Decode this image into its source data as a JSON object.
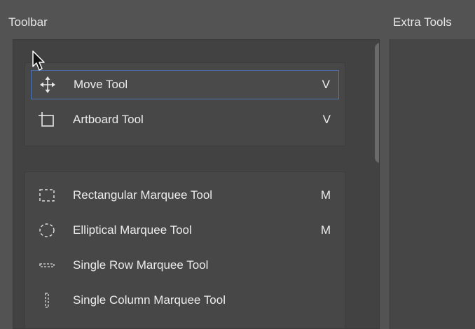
{
  "panels": {
    "toolbar_title": "Toolbar",
    "extra_title": "Extra Tools"
  },
  "groups": [
    {
      "tools": [
        {
          "label": "Move Tool",
          "shortcut": "V",
          "icon": "move-icon",
          "selected": true
        },
        {
          "label": "Artboard Tool",
          "shortcut": "V",
          "icon": "artboard-icon",
          "selected": false
        }
      ]
    },
    {
      "tools": [
        {
          "label": "Rectangular Marquee Tool",
          "shortcut": "M",
          "icon": "rectangular-marquee-icon",
          "selected": false
        },
        {
          "label": "Elliptical Marquee Tool",
          "shortcut": "M",
          "icon": "elliptical-marquee-icon",
          "selected": false
        },
        {
          "label": "Single Row Marquee Tool",
          "shortcut": "",
          "icon": "single-row-marquee-icon",
          "selected": false
        },
        {
          "label": "Single Column Marquee Tool",
          "shortcut": "",
          "icon": "single-column-marquee-icon",
          "selected": false
        }
      ]
    }
  ],
  "colors": {
    "background": "#535353",
    "pane": "#424242",
    "group": "#474747",
    "selection_border": "#4a73b8",
    "text": "#ececec"
  }
}
